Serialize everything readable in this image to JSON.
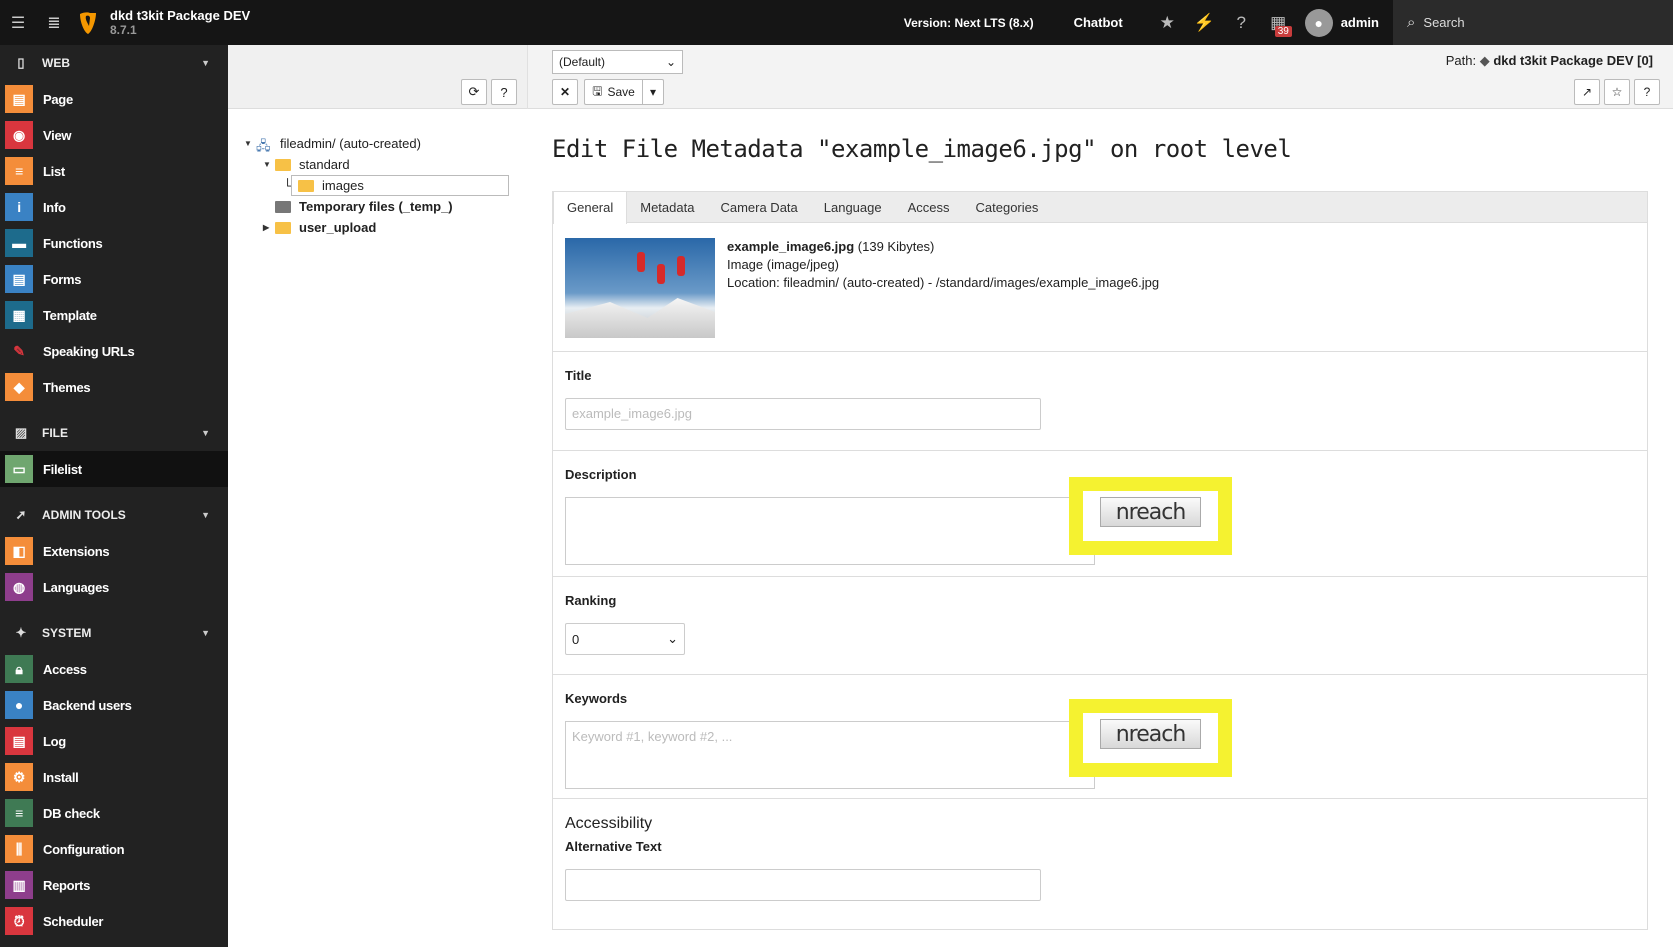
{
  "topbar": {
    "site_name": "dkd t3kit Package DEV",
    "site_version": "8.7.1",
    "version_label": "Version:",
    "version_value": "Next LTS (8.x)",
    "chatbot": "Chatbot",
    "notifications_count": "39",
    "user": "admin",
    "search_label": "Search"
  },
  "sidebar": {
    "groups": [
      {
        "label": "WEB",
        "items": [
          "Page",
          "View",
          "List",
          "Info",
          "Functions",
          "Forms",
          "Template",
          "Speaking URLs",
          "Themes"
        ]
      },
      {
        "label": "FILE",
        "items": [
          "Filelist"
        ]
      },
      {
        "label": "ADMIN TOOLS",
        "items": [
          "Extensions",
          "Languages"
        ]
      },
      {
        "label": "SYSTEM",
        "items": [
          "Access",
          "Backend users",
          "Log",
          "Install",
          "DB check",
          "Configuration",
          "Reports",
          "Scheduler"
        ]
      }
    ],
    "colors": {
      "Page": "#f48d3a",
      "View": "#d9363e",
      "List": "#f48d3a",
      "Info": "#3a82c4",
      "Functions": "#1d6b8c",
      "Forms": "#3a82c4",
      "Template": "#1d6b8c",
      "Speaking URLs": "#d9363e",
      "Themes": "#f48d3a",
      "Filelist": "#6fa66f",
      "Extensions": "#f48d3a",
      "Languages": "#8e3e8c",
      "Access": "#3f7a54",
      "Backend users": "#3a82c4",
      "Log": "#d9363e",
      "Install": "#f48d3a",
      "DB check": "#3f7a54",
      "Configuration": "#f48d3a",
      "Reports": "#8e3e8c",
      "Scheduler": "#d9363e"
    }
  },
  "tree": {
    "root": "fileadmin/ (auto-created)",
    "standard": "standard",
    "images": "images",
    "temp": "Temporary files (_temp_)",
    "user_upload": "user_upload"
  },
  "docheader": {
    "language": "(Default)",
    "save": "Save",
    "path_label": "Path:",
    "path_value": "dkd t3kit Package DEV [0]"
  },
  "page": {
    "title": "Edit File Metadata \"example_image6.jpg\" on root level",
    "tabs": [
      "General",
      "Metadata",
      "Camera Data",
      "Language",
      "Access",
      "Categories"
    ],
    "active_tab": "General"
  },
  "file": {
    "name": "example_image6.jpg",
    "size": "(139 Kibytes)",
    "type": "Image (image/jpeg)",
    "location": "Location: fileadmin/ (auto-created) - /standard/images/example_image6.jpg"
  },
  "form": {
    "title_label": "Title",
    "title_placeholder": "example_image6.jpg",
    "description_label": "Description",
    "ranking_label": "Ranking",
    "ranking_value": "0",
    "keywords_label": "Keywords",
    "keywords_placeholder": "Keyword #1, keyword #2, ...",
    "accessibility_head": "Accessibility",
    "alt_label": "Alternative Text",
    "nreach_label": "nreach"
  }
}
